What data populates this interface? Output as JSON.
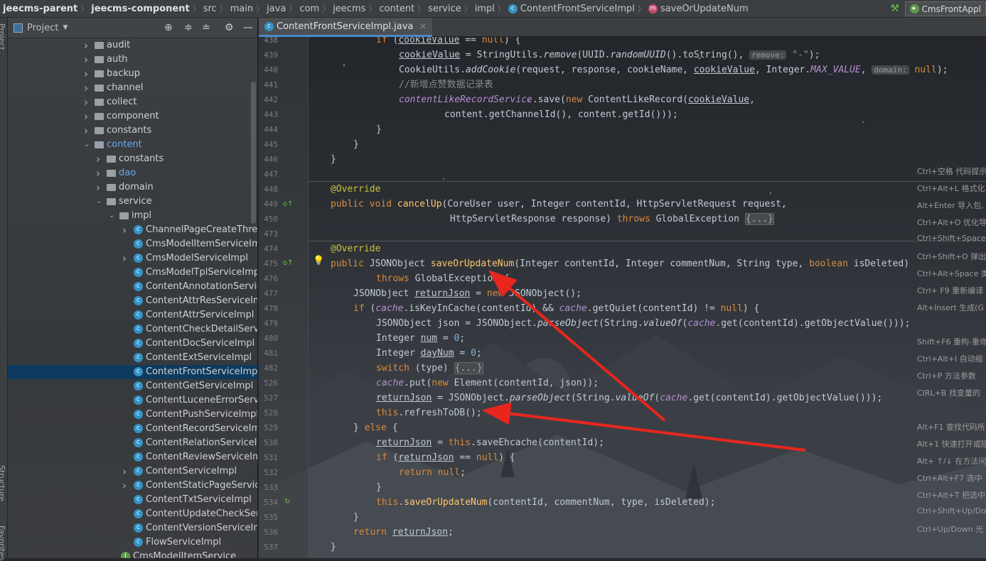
{
  "breadcrumb": [
    {
      "t": "jeecms-parent",
      "b": true
    },
    {
      "t": "jeecms-component",
      "b": true
    },
    {
      "t": "src"
    },
    {
      "t": "main"
    },
    {
      "t": "java"
    },
    {
      "t": "com"
    },
    {
      "t": "jeecms"
    },
    {
      "t": "content"
    },
    {
      "t": "service"
    },
    {
      "t": "impl"
    },
    {
      "t": "ContentFrontServiceImpl",
      "icon": "c"
    },
    {
      "t": "saveOrUpdateNum",
      "icon": "m"
    }
  ],
  "run_config": "CmsFrontAppl",
  "left_strip": {
    "project": "Project",
    "structure": "Structure",
    "favorites": "Favorites"
  },
  "project_panel": {
    "title": "Project",
    "icon_glyphs": [
      "target",
      "expand-all",
      "collapse-all",
      "gear",
      "minimize"
    ]
  },
  "tree": [
    {
      "label": "audit",
      "lvl": 0,
      "type": "folder",
      "arrow": ">"
    },
    {
      "label": "auth",
      "lvl": 0,
      "type": "folder",
      "arrow": ">"
    },
    {
      "label": "backup",
      "lvl": 0,
      "type": "folder",
      "arrow": ">"
    },
    {
      "label": "channel",
      "lvl": 0,
      "type": "folder",
      "arrow": ">"
    },
    {
      "label": "collect",
      "lvl": 0,
      "type": "folder",
      "arrow": ">"
    },
    {
      "label": "component",
      "lvl": 0,
      "type": "folder",
      "arrow": ">"
    },
    {
      "label": "constants",
      "lvl": 0,
      "type": "folder",
      "arrow": ">"
    },
    {
      "label": "content",
      "lvl": 0,
      "type": "folder",
      "arrow": "v",
      "blue": true
    },
    {
      "label": "constants",
      "lvl": 1,
      "type": "folder",
      "arrow": ">"
    },
    {
      "label": "dao",
      "lvl": 1,
      "type": "folder",
      "arrow": ">",
      "blue": true
    },
    {
      "label": "domain",
      "lvl": 1,
      "type": "folder",
      "arrow": ">"
    },
    {
      "label": "service",
      "lvl": 1,
      "type": "folder",
      "arrow": "v"
    },
    {
      "label": "impl",
      "lvl": 2,
      "type": "folder",
      "arrow": "v"
    },
    {
      "label": "ChannelPageCreateThreadS",
      "lvl": 3,
      "type": "class",
      "arrow": ">"
    },
    {
      "label": "CmsModelItemServiceImpl",
      "lvl": 3,
      "type": "class"
    },
    {
      "label": "CmsModelServiceImpl",
      "lvl": 3,
      "type": "class",
      "arrow": ">"
    },
    {
      "label": "CmsModelTplServiceImpl",
      "lvl": 3,
      "type": "class"
    },
    {
      "label": "ContentAnnotationServiceIn",
      "lvl": 3,
      "type": "class"
    },
    {
      "label": "ContentAttrResServiceImpl",
      "lvl": 3,
      "type": "class"
    },
    {
      "label": "ContentAttrServiceImpl",
      "lvl": 3,
      "type": "class"
    },
    {
      "label": "ContentCheckDetailServiceI",
      "lvl": 3,
      "type": "class"
    },
    {
      "label": "ContentDocServiceImpl",
      "lvl": 3,
      "type": "class"
    },
    {
      "label": "ContentExtServiceImpl",
      "lvl": 3,
      "type": "class"
    },
    {
      "label": "ContentFrontServiceImpl",
      "lvl": 3,
      "type": "class",
      "selected": true
    },
    {
      "label": "ContentGetServiceImpl",
      "lvl": 3,
      "type": "class"
    },
    {
      "label": "ContentLuceneErrorService",
      "lvl": 3,
      "type": "class"
    },
    {
      "label": "ContentPushServiceImpl",
      "lvl": 3,
      "type": "class"
    },
    {
      "label": "ContentRecordServiceImpl",
      "lvl": 3,
      "type": "class"
    },
    {
      "label": "ContentRelationServiceImpl",
      "lvl": 3,
      "type": "class"
    },
    {
      "label": "ContentReviewServiceImpl",
      "lvl": 3,
      "type": "class"
    },
    {
      "label": "ContentServiceImpl",
      "lvl": 3,
      "type": "class",
      "arrow": ">"
    },
    {
      "label": "ContentStaticPageServiceIm",
      "lvl": 3,
      "type": "class",
      "arrow": ">"
    },
    {
      "label": "ContentTxtServiceImpl",
      "lvl": 3,
      "type": "class"
    },
    {
      "label": "ContentUpdateCheckServic",
      "lvl": 3,
      "type": "class"
    },
    {
      "label": "ContentVersionServiceImpl",
      "lvl": 3,
      "type": "class"
    },
    {
      "label": "FlowServiceImpl",
      "lvl": 3,
      "type": "class"
    },
    {
      "label": "CmsModelItemService",
      "lvl": 2,
      "type": "interface"
    }
  ],
  "editor_tab": {
    "label": "ContentFrontServiceImpl.java"
  },
  "code": [
    {
      "n": "438",
      "i": 12,
      "t": [
        [
          "kw",
          "if "
        ],
        [
          "",
          "("
        ],
        [
          "u",
          "cookieValue"
        ],
        [
          "",
          " == "
        ],
        [
          "kw",
          "null"
        ],
        [
          "",
          ") {"
        ]
      ]
    },
    {
      "n": "439",
      "i": 16,
      "t": [
        [
          "u",
          "cookieValue"
        ],
        [
          "",
          " = StringUtils."
        ],
        [
          "it",
          "remove"
        ],
        [
          "",
          "(UUID."
        ],
        [
          "it",
          "randomUUID"
        ],
        [
          "",
          "().toString(), "
        ],
        [
          "hint",
          "remove:"
        ],
        [
          "st",
          " \"-\""
        ],
        [
          "",
          ");"
        ]
      ]
    },
    {
      "n": "440",
      "i": 16,
      "t": [
        [
          "",
          "CookieUtils."
        ],
        [
          "it",
          "addCookie"
        ],
        [
          "",
          "(request, response, cookieName, "
        ],
        [
          "u",
          "cookieValue"
        ],
        [
          "",
          ", Integer."
        ],
        [
          "fd",
          "MAX_VALUE"
        ],
        [
          "",
          ", "
        ],
        [
          "hint",
          "domain:"
        ],
        [
          "kw",
          " null"
        ],
        [
          "",
          ");"
        ]
      ]
    },
    {
      "n": "441",
      "i": 16,
      "t": [
        [
          "cm",
          "//新增点赞数据记录表"
        ]
      ]
    },
    {
      "n": "442",
      "i": 16,
      "t": [
        [
          "fd",
          "contentLikeRecordService"
        ],
        [
          "",
          ".save("
        ],
        [
          "kw",
          "new "
        ],
        [
          "",
          "ContentLikeRecord("
        ],
        [
          "u",
          "cookieValue"
        ],
        [
          "",
          ","
        ]
      ]
    },
    {
      "n": "443",
      "i": 24,
      "t": [
        [
          "",
          "content.getChannelId(), content.getId()));"
        ]
      ]
    },
    {
      "n": "444",
      "i": 12,
      "t": [
        [
          "",
          "}"
        ]
      ]
    },
    {
      "n": "445",
      "i": 8,
      "t": [
        [
          "",
          "}"
        ]
      ]
    },
    {
      "n": "446",
      "i": 4,
      "t": [
        [
          "",
          "}"
        ]
      ]
    },
    {
      "n": "447",
      "i": 0,
      "t": []
    },
    {
      "n": "448",
      "i": 4,
      "t": [
        [
          "an",
          "@Override"
        ]
      ]
    },
    {
      "n": "449",
      "i": 4,
      "t": [
        [
          "kw",
          "public void "
        ],
        [
          "fn",
          "cancelUp"
        ],
        [
          "",
          "(CoreUser user, Integer contentId, HttpServletRequest request,"
        ]
      ]
    },
    {
      "n": "450",
      "i": 25,
      "t": [
        [
          "",
          "HttpServletResponse response) "
        ],
        [
          "kw",
          "throws "
        ],
        [
          "",
          "GlobalException "
        ],
        [
          "fld",
          "{...}"
        ]
      ]
    },
    {
      "n": "473",
      "i": 0,
      "t": []
    },
    {
      "n": "474",
      "i": 4,
      "t": [
        [
          "an",
          "@Override"
        ]
      ]
    },
    {
      "n": "475",
      "i": 4,
      "t": [
        [
          "kw",
          "public "
        ],
        [
          "",
          "JSONObject "
        ],
        [
          "fn",
          "saveOrUpdateNum"
        ],
        [
          "",
          "(Integer contentId, Integer commentNum, String type, "
        ],
        [
          "kw",
          "boolean "
        ],
        [
          "",
          "isDeleted)"
        ]
      ]
    },
    {
      "n": "476",
      "i": 12,
      "t": [
        [
          "kw",
          "throws "
        ],
        [
          "",
          "GlobalException {"
        ]
      ]
    },
    {
      "n": "477",
      "i": 8,
      "t": [
        [
          "",
          "JSONObject "
        ],
        [
          "u",
          "returnJson"
        ],
        [
          "",
          " = "
        ],
        [
          "kw",
          "new "
        ],
        [
          "",
          "JSONObject();"
        ]
      ]
    },
    {
      "n": "478",
      "i": 8,
      "t": [
        [
          "kw",
          "if "
        ],
        [
          "",
          "("
        ],
        [
          "fd",
          "cache"
        ],
        [
          "",
          ".isKeyInCache(contentId) && "
        ],
        [
          "fd",
          "cache"
        ],
        [
          "",
          ".getQuiet(contentId) != "
        ],
        [
          "kw",
          "null"
        ],
        [
          "",
          ") {"
        ]
      ]
    },
    {
      "n": "479",
      "i": 12,
      "t": [
        [
          "",
          "JSONObject json = JSONObject."
        ],
        [
          "it",
          "parseObject"
        ],
        [
          "",
          "(String."
        ],
        [
          "it",
          "valueOf"
        ],
        [
          "",
          "("
        ],
        [
          "fd",
          "cache"
        ],
        [
          "",
          ".get(contentId).getObjectValue()));"
        ]
      ]
    },
    {
      "n": "480",
      "i": 12,
      "t": [
        [
          "",
          "Integer "
        ],
        [
          "u",
          "num"
        ],
        [
          "",
          " = "
        ],
        [
          "nm",
          "0"
        ],
        [
          "",
          ";"
        ]
      ]
    },
    {
      "n": "481",
      "i": 12,
      "t": [
        [
          "",
          "Integer "
        ],
        [
          "u",
          "dayNum"
        ],
        [
          "",
          " = "
        ],
        [
          "nm",
          "0"
        ],
        [
          "",
          ";"
        ]
      ]
    },
    {
      "n": "482",
      "i": 12,
      "t": [
        [
          "kw",
          "switch "
        ],
        [
          "",
          "(type) "
        ],
        [
          "fld",
          "{...}"
        ]
      ]
    },
    {
      "n": "526",
      "i": 12,
      "t": [
        [
          "fd",
          "cache"
        ],
        [
          "",
          ".put("
        ],
        [
          "kw",
          "new "
        ],
        [
          "",
          "Element(contentId, json));"
        ]
      ]
    },
    {
      "n": "527",
      "i": 12,
      "t": [
        [
          "u",
          "returnJson"
        ],
        [
          "",
          " = JSONObject."
        ],
        [
          "it",
          "parseObject"
        ],
        [
          "",
          "(String."
        ],
        [
          "it",
          "valueOf"
        ],
        [
          "",
          "("
        ],
        [
          "fd",
          "cache"
        ],
        [
          "",
          ".get(contentId).getObjectValue()));"
        ]
      ]
    },
    {
      "n": "528",
      "i": 12,
      "t": [
        [
          "kw",
          "this"
        ],
        [
          "",
          ".refreshToDB();"
        ]
      ]
    },
    {
      "n": "529",
      "i": 8,
      "t": [
        [
          "",
          "} "
        ],
        [
          "kw",
          "else "
        ],
        [
          "",
          "{"
        ]
      ]
    },
    {
      "n": "530",
      "i": 12,
      "t": [
        [
          "u",
          "returnJson"
        ],
        [
          "",
          " = "
        ],
        [
          "kw",
          "this"
        ],
        [
          "",
          ".saveEhcache(contentId);"
        ]
      ]
    },
    {
      "n": "531",
      "i": 12,
      "t": [
        [
          "kw",
          "if "
        ],
        [
          "",
          "("
        ],
        [
          "u",
          "returnJson"
        ],
        [
          "",
          " == "
        ],
        [
          "kw",
          "null"
        ],
        [
          "",
          ") {"
        ]
      ]
    },
    {
      "n": "532",
      "i": 16,
      "t": [
        [
          "kw",
          "return null"
        ],
        [
          "",
          ";"
        ]
      ]
    },
    {
      "n": "533",
      "i": 12,
      "t": [
        [
          "",
          "}"
        ]
      ]
    },
    {
      "n": "534",
      "i": 12,
      "t": [
        [
          "kw",
          "this"
        ],
        [
          "",
          "."
        ],
        [
          "fn",
          "saveOrUpdateNum"
        ],
        [
          "",
          "(contentId, commentNum, type, isDeleted);"
        ]
      ]
    },
    {
      "n": "535",
      "i": 8,
      "t": [
        [
          "",
          "}"
        ]
      ]
    },
    {
      "n": "536",
      "i": 8,
      "t": [
        [
          "kw",
          "return "
        ],
        [
          "u",
          "returnJson"
        ],
        [
          "",
          ";"
        ]
      ]
    },
    {
      "n": "537",
      "i": 4,
      "t": [
        [
          "",
          "}"
        ]
      ]
    }
  ],
  "shortcut_hints": [
    "Ctrl+空格 代码提示",
    "Ctrl+Alt+L 格式化",
    "Alt+Enter 导入包,",
    "Ctrl+Alt+O 优化导",
    "Ctrl+Shift+Space",
    "Ctrl+Shift+O 弹出",
    "Ctrl+Alt+Space 类",
    "Ctrl+ F9 重新编译",
    "Alt+Insert 生成(G",
    "",
    "Shift+F6 重构-重命",
    "Ctrl+Alt+I 自动缩",
    "Ctrl+P 方法参数",
    "CIRL+B 找变量的",
    "",
    "Alt+F1 查找代码所",
    "Alt+1 快速打开或隐",
    "Alt+ ↑/↓ 在方法间",
    "Ctrl+Alt+F7 选中",
    "Ctrl+Alt+T 把选中",
    "Ctrl+Shift+Up/Do",
    "Ctrl+Up/Down 光"
  ],
  "colors": {
    "annotation_arrow": "#e8261d",
    "accent": "#4a88c7"
  }
}
